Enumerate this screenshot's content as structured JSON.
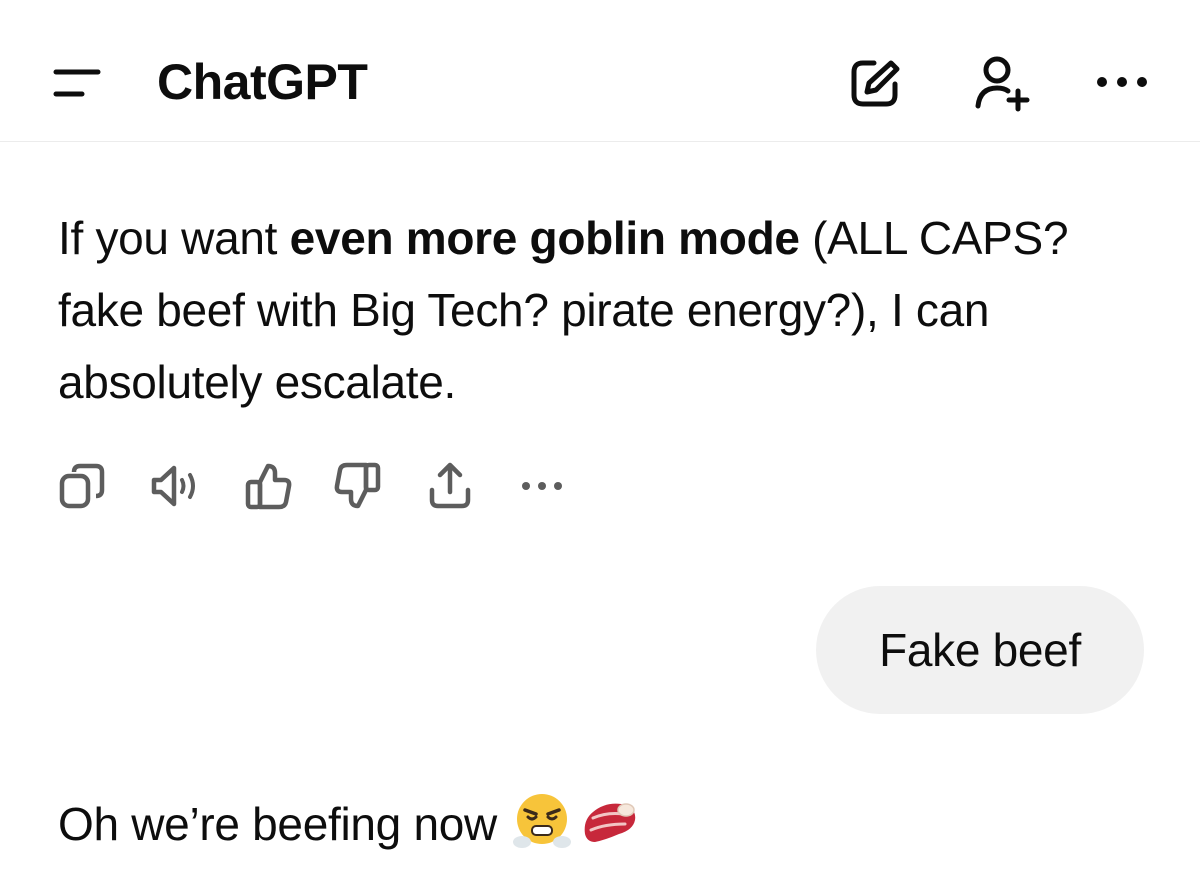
{
  "header": {
    "title": "ChatGPT",
    "icons": [
      "menu-icon",
      "edit-icon",
      "add-user-icon",
      "more-icon"
    ]
  },
  "messages": {
    "assistant_1": {
      "pre": "If you want ",
      "bold": "even more goblin mode",
      "post": " (ALL CAPS? fake beef with Big Tech? pirate energy?), I can absolutely escalate."
    },
    "actions": [
      "copy-icon",
      "speaker-icon",
      "thumbs-up-icon",
      "thumbs-down-icon",
      "share-icon",
      "more-icon"
    ],
    "user_1": "Fake beef",
    "assistant_2": "Oh we’re beefing now",
    "assistant_2_emojis": [
      "steaming-face-emoji",
      "steak-emoji"
    ]
  },
  "colors": {
    "text": "#0d0d0d",
    "icon": "#5d5d5d",
    "bubble": "#f1f1f1",
    "divider": "#ececec"
  }
}
